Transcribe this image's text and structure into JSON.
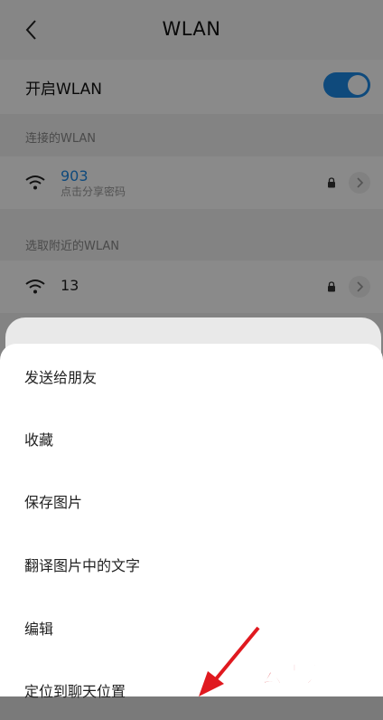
{
  "header": {
    "title": "WLAN",
    "back_icon": "chevron-left-icon"
  },
  "wlan_toggle": {
    "label": "开启WLAN",
    "on": true,
    "accent": "#1d89e6"
  },
  "connected": {
    "section_label": "连接的WLAN",
    "network": {
      "name": "903",
      "subtitle": "点击分享密码",
      "name_color": "#1d89e6",
      "secured": true
    }
  },
  "nearby": {
    "section_label": "选取附近的WLAN",
    "networks": [
      {
        "name": "13",
        "secured": true
      }
    ]
  },
  "sheet": {
    "items": [
      "发送给朋友",
      "收藏",
      "保存图片",
      "翻译图片中的文字",
      "编辑",
      "定位到聊天位置"
    ]
  },
  "watermark": {
    "text": "云南龙网",
    "color": "#d8252c"
  },
  "annotation": {
    "icon": "red-arrow-icon",
    "color": "#e0191f"
  }
}
